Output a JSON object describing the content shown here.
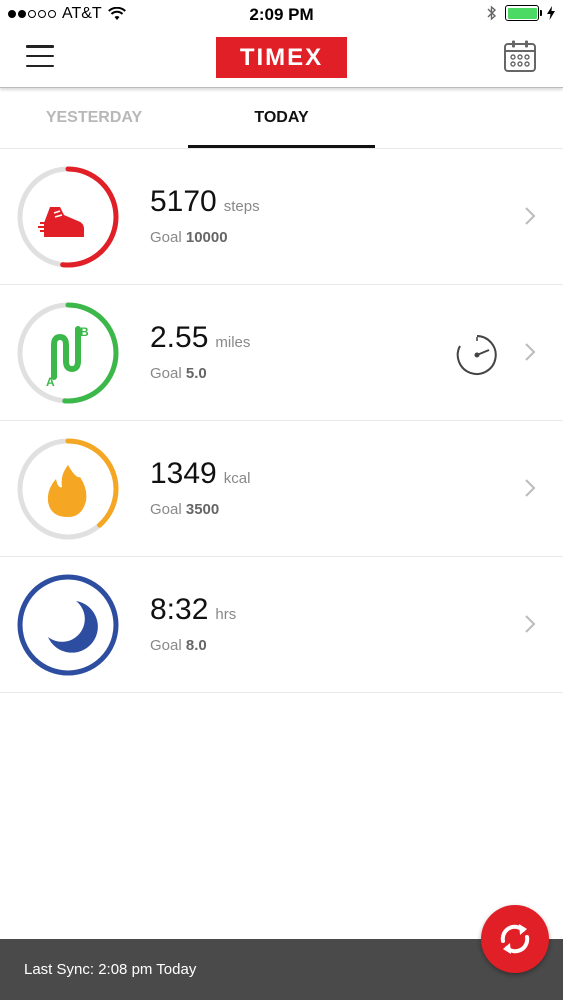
{
  "status_bar": {
    "carrier": "AT&T",
    "time": "2:09 PM",
    "battery_level": 1.0
  },
  "header": {
    "logo_text": "TIMEX",
    "brand_color": "#e01f26"
  },
  "tabs": [
    {
      "label": "YESTERDAY",
      "active": false
    },
    {
      "label": "TODAY",
      "active": true
    }
  ],
  "metrics": [
    {
      "icon": "shoe-icon",
      "value": "5170",
      "unit": "steps",
      "goal_label": "Goal",
      "goal": "10000",
      "progress": 0.517,
      "color": "#e01f26"
    },
    {
      "icon": "distance-ab-icon",
      "value": "2.55",
      "unit": "miles",
      "goal_label": "Goal",
      "goal": "5.0",
      "progress": 0.51,
      "color": "#3cb84a"
    },
    {
      "icon": "flame-icon",
      "value": "1349",
      "unit": "kcal",
      "goal_label": "Goal",
      "goal": "3500",
      "progress": 0.385,
      "color": "#f5a623"
    },
    {
      "icon": "moon-icon",
      "value": "8:32",
      "unit": "hrs",
      "goal_label": "Goal",
      "goal": "8.0",
      "progress": 1.0,
      "color": "#2d4da0"
    }
  ],
  "footer": {
    "last_sync": "Last Sync: 2:08 pm Today"
  }
}
